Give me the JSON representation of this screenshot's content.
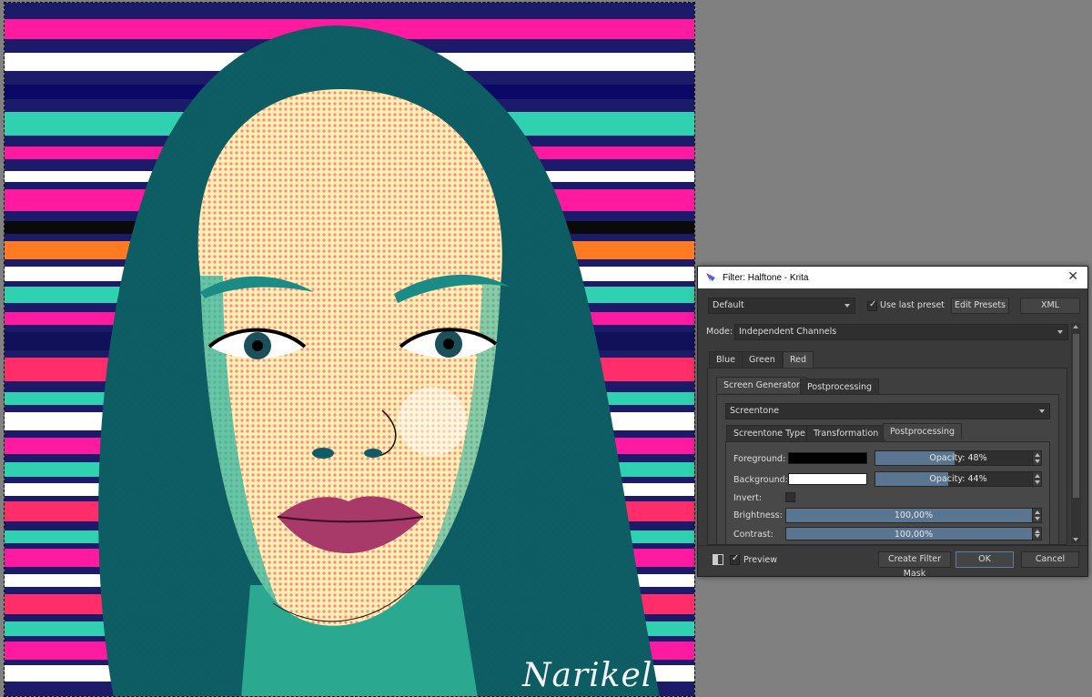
{
  "canvas": {
    "signature": "Narikel"
  },
  "dialog": {
    "title": "Filter: Halftone - Krita",
    "preset_combo": "Default",
    "use_last_preset_label": "Use last preset",
    "use_last_preset_checked": true,
    "edit_presets_label": "Edit Presets",
    "xml_label": "XML",
    "mode_label": "Mode:",
    "mode_value": "Independent Channels",
    "channel_tabs": [
      "Blue",
      "Green",
      "Red"
    ],
    "channel_active": "Red",
    "subtabs": [
      "Screen Generator",
      "Postprocessing"
    ],
    "subtab_active": "Screen Generator",
    "generator_combo": "Screentone",
    "inner_tabs": [
      "Screentone Type",
      "Transformation",
      "Postprocessing"
    ],
    "inner_active": "Postprocessing",
    "foreground_label": "Foreground:",
    "foreground_color": "#000000",
    "foreground_opacity": "Opacity: 48%",
    "foreground_opacity_value": 48,
    "background_label": "Background:",
    "background_color": "#ffffff",
    "background_opacity": "Opacity: 44%",
    "background_opacity_value": 44,
    "invert_label": "Invert:",
    "invert_checked": false,
    "brightness_label": "Brightness:",
    "brightness_value": "100,00%",
    "contrast_label": "Contrast:",
    "contrast_value": "100,00%",
    "preview_label": "Preview",
    "preview_checked": true,
    "create_mask_label": "Create Filter Mask",
    "ok_label": "OK",
    "cancel_label": "Cancel"
  },
  "colors": {
    "accent": "#5a7590",
    "dialog_bg": "#3a3a3a",
    "workspace_bg": "#808080"
  }
}
